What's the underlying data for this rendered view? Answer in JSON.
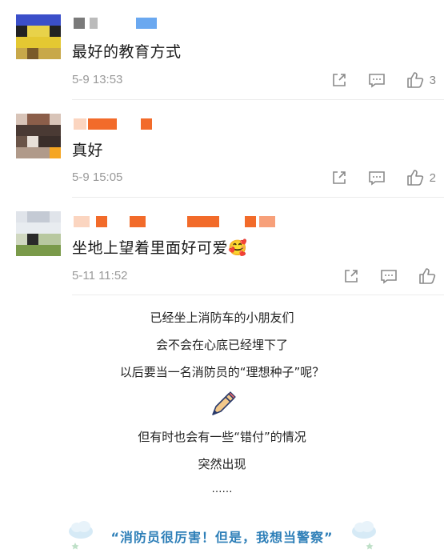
{
  "comments": [
    {
      "text": "最好的教育方式",
      "date": "5-9 13:53",
      "likes": "3"
    },
    {
      "text": "真好",
      "date": "5-9 15:05",
      "likes": "2"
    },
    {
      "text": "坐地上望着里面好可爱🥰",
      "date": "5-11 11:52",
      "likes": ""
    }
  ],
  "icons": [
    "share-icon",
    "comment-icon",
    "like-icon",
    "pencil-icon",
    "cloud-icon"
  ],
  "story": {
    "line1": "已经坐上消防车的小朋友们",
    "line2": "会不会在心底已经埋下了",
    "line3": "以后要当一名消防员的“理想种子”呢？",
    "line4": "但有时也会有一些“错付”的情况",
    "line5": "突然出现",
    "line6": "……"
  },
  "banner": {
    "text": "“消防员很厉害！但是，我想当警察”"
  },
  "colors": {
    "banner": "#2e7fb8",
    "meta": "#9a9a9a",
    "divider": "#ececec"
  }
}
